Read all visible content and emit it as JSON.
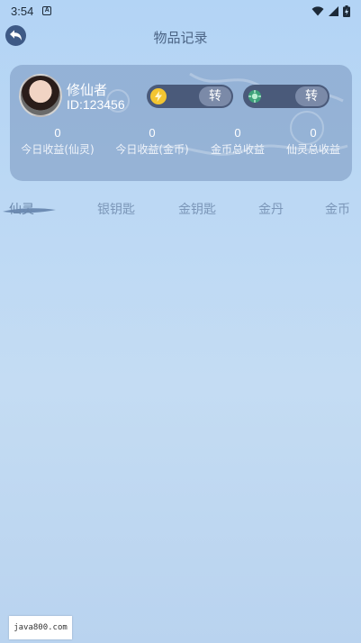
{
  "status_bar": {
    "time": "3:54",
    "notification_icon_label": "A",
    "icons": [
      "wifi-icon",
      "signal-icon",
      "battery-icon"
    ]
  },
  "header": {
    "title": "物品记录",
    "back_icon": "back-arrow-icon"
  },
  "profile": {
    "name": "修仙者",
    "id_label": "ID:123456",
    "avatar": "avatar-photo",
    "gold_exchange": {
      "icon": "gold-coin-icon",
      "button": "转"
    },
    "spirit_exchange": {
      "icon": "green-gem-icon",
      "button": "转"
    }
  },
  "stats": [
    {
      "value": "0",
      "label": "今日收益(仙灵)"
    },
    {
      "value": "0",
      "label": "今日收益(金币)"
    },
    {
      "value": "0",
      "label": "金币总收益"
    },
    {
      "value": "0",
      "label": "仙灵总收益"
    }
  ],
  "tabs": [
    {
      "label": "仙灵",
      "active": true
    },
    {
      "label": "银钥匙",
      "active": false
    },
    {
      "label": "金钥匙",
      "active": false
    },
    {
      "label": "金丹",
      "active": false
    },
    {
      "label": "金币",
      "active": false
    }
  ],
  "watermark": "java800.com",
  "colors": {
    "background_top": "#b3d4f5",
    "card": "#7896be",
    "pill": "#4a5a7a",
    "tab_text": "#7b96b8"
  }
}
